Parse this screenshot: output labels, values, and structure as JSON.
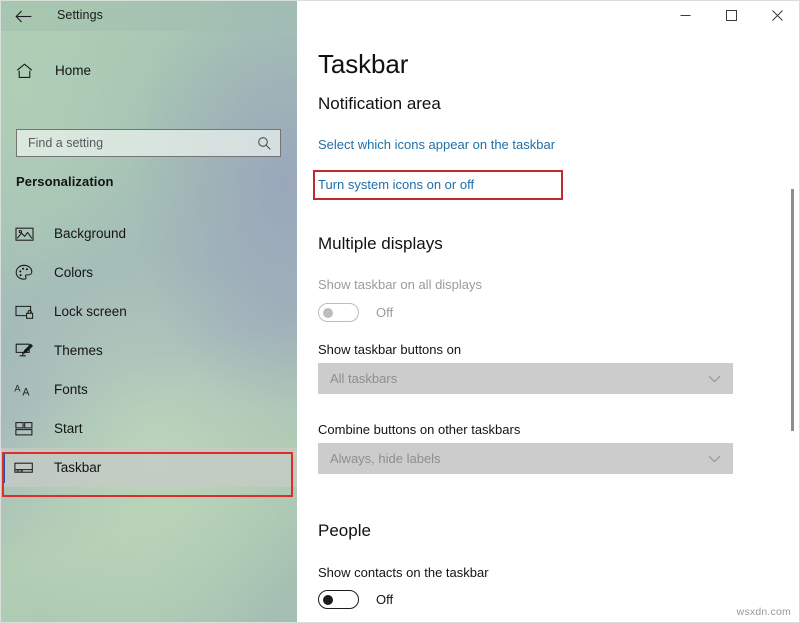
{
  "window": {
    "title": "Settings",
    "back_icon": "back-arrow-icon",
    "controls": {
      "minimize": "minimize-icon",
      "maximize": "maximize-icon",
      "close": "close-icon"
    }
  },
  "sidebar": {
    "home": {
      "label": "Home",
      "icon": "home-icon"
    },
    "search": {
      "placeholder": "Find a setting",
      "value": "",
      "icon": "search-icon"
    },
    "category": "Personalization",
    "items": [
      {
        "label": "Background",
        "icon": "picture-icon",
        "selected": false
      },
      {
        "label": "Colors",
        "icon": "palette-icon",
        "selected": false
      },
      {
        "label": "Lock screen",
        "icon": "lock-screen-icon",
        "selected": false
      },
      {
        "label": "Themes",
        "icon": "themes-brush-icon",
        "selected": false
      },
      {
        "label": "Fonts",
        "icon": "fonts-aa-icon",
        "selected": false
      },
      {
        "label": "Start",
        "icon": "start-tiles-icon",
        "selected": false
      },
      {
        "label": "Taskbar",
        "icon": "taskbar-icon",
        "selected": true
      }
    ]
  },
  "main": {
    "page_title": "Taskbar",
    "notification_area": {
      "heading": "Notification area",
      "links": [
        "Select which icons appear on the taskbar",
        "Turn system icons on or off"
      ]
    },
    "multiple_displays": {
      "heading": "Multiple displays",
      "show_taskbar_all": {
        "label": "Show taskbar on all displays",
        "state": "Off",
        "disabled": true
      },
      "show_buttons_on": {
        "label": "Show taskbar buttons on",
        "value": "All taskbars",
        "disabled": true
      },
      "combine_buttons": {
        "label": "Combine buttons on other taskbars",
        "value": "Always, hide labels",
        "disabled": true
      }
    },
    "people": {
      "heading": "People",
      "show_contacts": {
        "label": "Show contacts on the taskbar",
        "state": "Off",
        "disabled": false
      }
    }
  },
  "annotations": {
    "link_highlight_color": "#c12a2a",
    "sidebar_highlight_color": "#e02c2c"
  },
  "accent_color": "#2d4ea8",
  "link_color": "#1f6fa8",
  "watermark": "wsxdn.com"
}
